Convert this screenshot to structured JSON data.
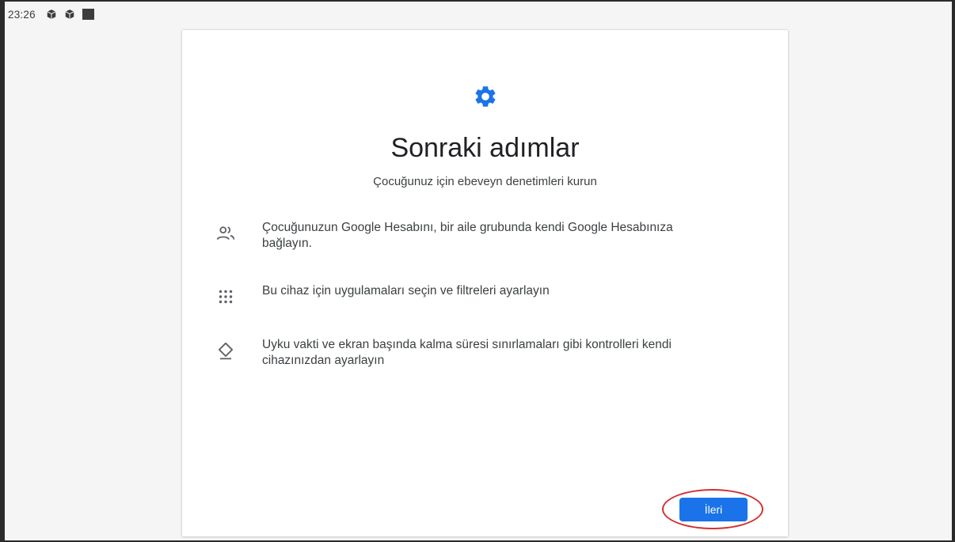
{
  "status_bar": {
    "time": "23:26",
    "icons": [
      "package-icon",
      "package-icon",
      "square-icon"
    ]
  },
  "header": {
    "icon": "gear-icon",
    "title": "Sonraki adımlar",
    "subtitle": "Çocuğunuz için ebeveyn denetimleri kurun"
  },
  "steps": [
    {
      "icon": "people-icon",
      "text_lines": [
        "Çocuğunuzun Google Hesabını, bir aile grubunda kendi Google Hesabınıza",
        "bağlayın."
      ]
    },
    {
      "icon": "apps-grid-icon",
      "text_lines": [
        "Bu cihaz için uygulamaları seçin ve filtreleri ayarlayın"
      ]
    },
    {
      "icon": "hourglass-icon",
      "text_lines": [
        "Uyku vakti ve ekran başında kalma süresi sınırlamaları gibi kontrolleri kendi",
        "cihazınızdan ayarlayın"
      ]
    }
  ],
  "actions": {
    "next_label": "İleri"
  },
  "colors": {
    "accent": "#1a73e8",
    "highlight_ring": "#d32f2f",
    "text": "#3c4043"
  }
}
